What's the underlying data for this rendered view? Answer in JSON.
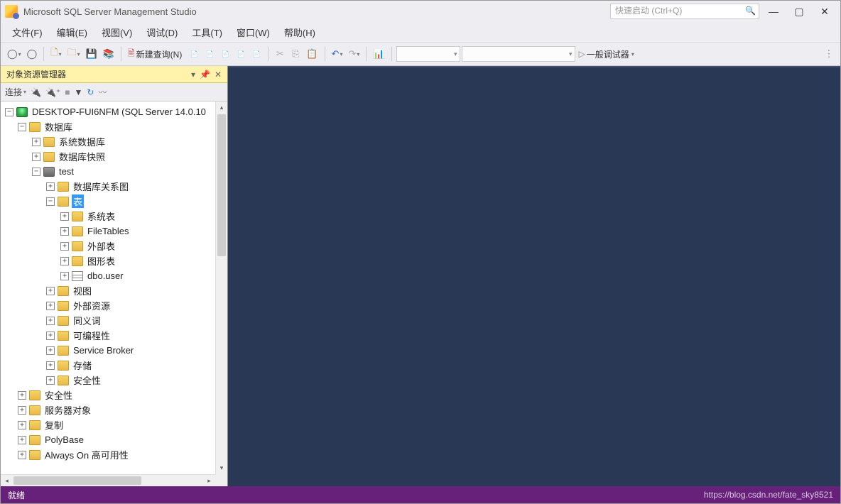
{
  "title": "Microsoft SQL Server Management Studio",
  "quicklaunch_placeholder": "快速启动 (Ctrl+Q)",
  "menu": [
    "文件(F)",
    "编辑(E)",
    "视图(V)",
    "调试(D)",
    "工具(T)",
    "窗口(W)",
    "帮助(H)"
  ],
  "toolbar": {
    "new_query": "新建查询(N)",
    "debugger_label": "一般调试器"
  },
  "panel": {
    "title": "对象资源管理器",
    "connect_label": "连接"
  },
  "tree": {
    "server": "DESKTOP-FUI6NFM (SQL Server 14.0.10",
    "databases": "数据库",
    "sys_db": "系统数据库",
    "db_snapshot": "数据库快照",
    "test": "test",
    "db_diagram": "数据库关系图",
    "tables": "表",
    "sys_tables": "系统表",
    "filetables": "FileTables",
    "ext_tables": "外部表",
    "graph_tables": "图形表",
    "dbo_user": "dbo.user",
    "views": "视图",
    "ext_res": "外部资源",
    "synonyms": "同义词",
    "programmability": "可编程性",
    "service_broker": "Service Broker",
    "storage": "存储",
    "security_db": "安全性",
    "security": "安全性",
    "server_objects": "服务器对象",
    "replication": "复制",
    "polybase": "PolyBase",
    "always_on": "Always On 高可用性"
  },
  "status": {
    "ready": "就绪",
    "watermark": "https://blog.csdn.net/fate_sky8521"
  }
}
